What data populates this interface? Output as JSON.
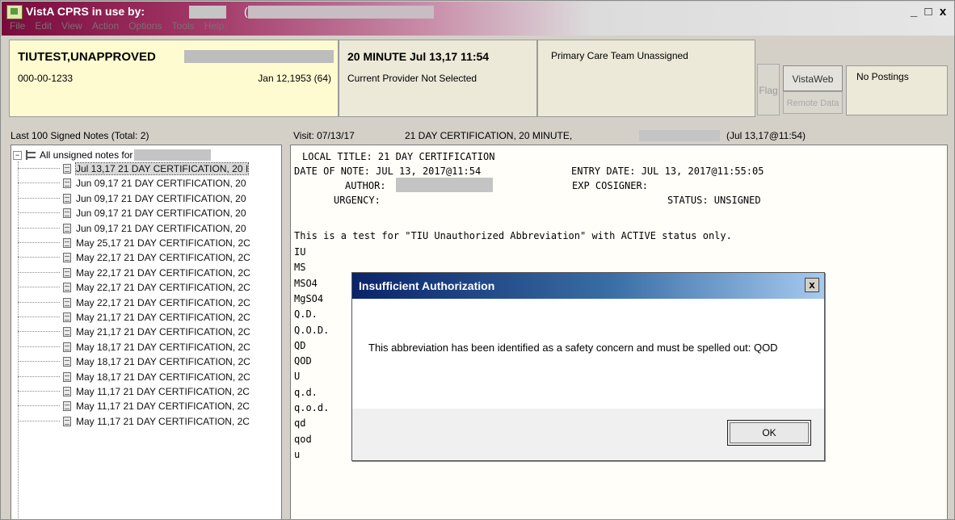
{
  "window": {
    "title": "VistA CPRS in use by:",
    "title_paren": "(",
    "controls": {
      "minimize": "_",
      "maximize": "□",
      "close": "x"
    }
  },
  "menu": [
    "File",
    "Edit",
    "View",
    "Action",
    "Options",
    "Tools",
    "Help"
  ],
  "patient": {
    "name": "TIUTEST,UNAPPROVED",
    "ssn": "000-00-1233",
    "dob_age": "Jan 12,1953 (64)"
  },
  "visit": {
    "line1": "20 MINUTE Jul 13,17 11:54",
    "line2": "Current Provider Not Selected"
  },
  "pcmm": {
    "text": "Primary Care Team Unassigned"
  },
  "buttons": {
    "flag": "Flag",
    "vistaweb": "VistaWeb",
    "remote_data": "Remote Data"
  },
  "postings": {
    "text": "No Postings"
  },
  "notes_panel": {
    "caption": "Last 100 Signed Notes (Total: 2)",
    "root_label": "All unsigned notes for",
    "items": [
      "Jul 13,17  21 DAY CERTIFICATION, 20 I",
      "Jun 09,17  21 DAY CERTIFICATION, 20",
      "Jun 09,17  21 DAY CERTIFICATION, 20",
      "Jun 09,17  21 DAY CERTIFICATION, 20",
      "Jun 09,17  21 DAY CERTIFICATION, 20",
      "May 25,17  21 DAY CERTIFICATION, 2C",
      "May 22,17  21 DAY CERTIFICATION, 2C",
      "May 22,17  21 DAY CERTIFICATION, 2C",
      "May 22,17  21 DAY CERTIFICATION, 2C",
      "May 22,17  21 DAY CERTIFICATION, 2C",
      "May 21,17  21 DAY CERTIFICATION, 2C",
      "May 21,17  21 DAY CERTIFICATION, 2C",
      "May 18,17  21 DAY CERTIFICATION, 2C",
      "May 18,17  21 DAY CERTIFICATION, 2C",
      "May 18,17  21 DAY CERTIFICATION, 2C",
      "May 11,17  21 DAY CERTIFICATION, 2C",
      "May 11,17  21 DAY CERTIFICATION, 2C",
      "May 11,17  21 DAY CERTIFICATION, 2C"
    ]
  },
  "note_view": {
    "caption_visit": "Visit: 07/13/17",
    "caption_title": "21 DAY CERTIFICATION, 20 MINUTE,",
    "caption_date": "(Jul 13,17@11:54)",
    "local_title": "LOCAL TITLE: 21 DAY CERTIFICATION",
    "date_of_note": "DATE OF NOTE: JUL 13, 2017@11:54",
    "entry_date": "ENTRY DATE: JUL 13, 2017@11:55:05",
    "author": "AUTHOR:",
    "exp_cosigner": "EXP COSIGNER:",
    "urgency": "URGENCY:",
    "status": "STATUS: UNSIGNED",
    "body": "This is a test for \"TIU Unauthorized Abbreviation\" with ACTIVE status only.",
    "abbreviations": [
      "IU",
      "MS",
      "MSO4",
      "MgSO4",
      "Q.D.",
      "Q.O.D.",
      "QD",
      "QOD",
      "U",
      "q.d.",
      "q.o.d.",
      "qd",
      "qod",
      "u"
    ]
  },
  "dialog": {
    "title": "Insufficient Authorization",
    "close": "x",
    "message": "This abbreviation has been identified as a safety concern and must be spelled out: QOD",
    "ok": "OK"
  }
}
